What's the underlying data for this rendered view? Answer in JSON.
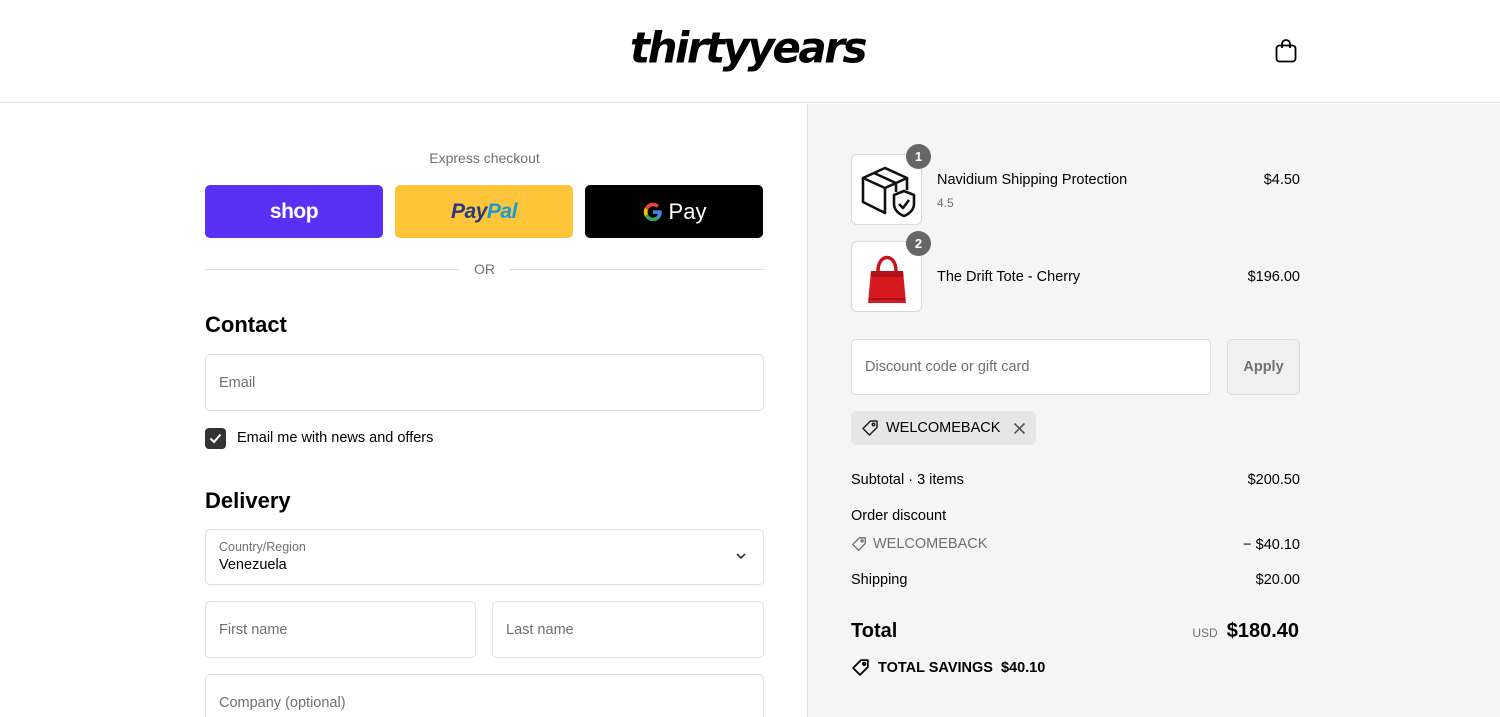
{
  "header": {
    "logo": "thirtyyears",
    "cart_icon": "shopping-bag-icon"
  },
  "express": {
    "title": "Express checkout",
    "shop_label": "shop",
    "paypal_label_1": "Pay",
    "paypal_label_2": "Pal",
    "gpay_label": "Pay",
    "or_label": "OR"
  },
  "contact": {
    "title": "Contact",
    "email_placeholder": "Email",
    "newsletter_label": "Email me with news and offers",
    "newsletter_checked": true
  },
  "delivery": {
    "title": "Delivery",
    "country_label": "Country/Region",
    "country_value": "Venezuela",
    "first_name_placeholder": "First name",
    "last_name_placeholder": "Last name",
    "company_placeholder": "Company (optional)"
  },
  "cart": {
    "items": [
      {
        "name": "Navidium Shipping Protection",
        "subtitle": "4.5",
        "quantity": "1",
        "price": "$4.50",
        "icon": "shipping-protection-icon"
      },
      {
        "name": "The Drift Tote - Cherry",
        "subtitle": "",
        "quantity": "2",
        "price": "$196.00",
        "icon": "red-tote-bag-image"
      }
    ],
    "discount_placeholder": "Discount code or gift card",
    "apply_label": "Apply",
    "applied_code": "WELCOMEBACK"
  },
  "summary": {
    "subtotal_label": "Subtotal · 3 items",
    "subtotal_value": "$200.50",
    "order_discount_label": "Order discount",
    "discount_code": "WELCOMEBACK",
    "discount_value": "− $40.10",
    "shipping_label": "Shipping",
    "shipping_value": "$20.00",
    "total_label": "Total",
    "currency": "USD",
    "total_value": "$180.40",
    "savings_label": "TOTAL SAVINGS",
    "savings_value": "$40.10"
  },
  "colors": {
    "shop_pay": "#5a31f4",
    "paypal": "#ffc439",
    "gpay": "#000000",
    "summary_bg": "#f5f5f5"
  }
}
